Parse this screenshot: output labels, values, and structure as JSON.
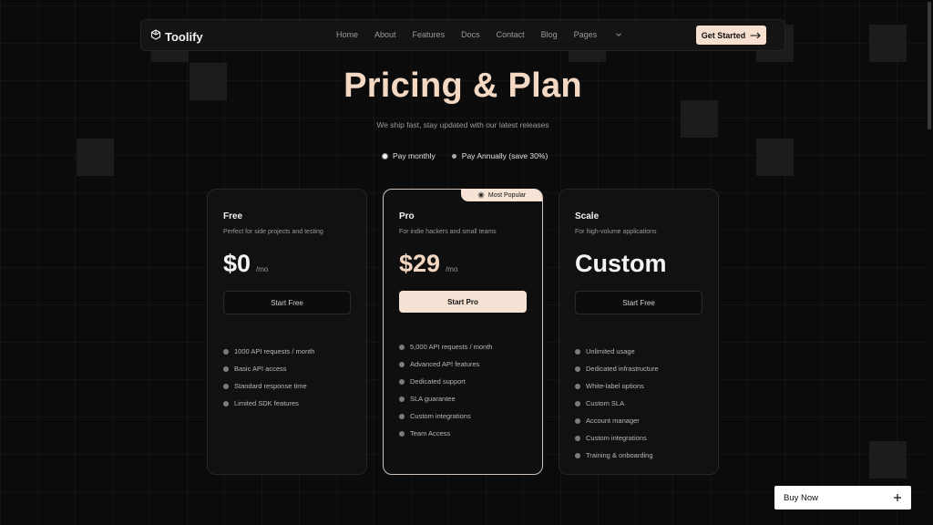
{
  "nav": {
    "brand": "Toolify",
    "links": [
      "Home",
      "About",
      "Features",
      "Docs",
      "Contact",
      "Blog"
    ],
    "pages_label": "Pages",
    "cta_label": "Get Started"
  },
  "hero": {
    "title": "Pricing & Plan",
    "subtitle": "We ship fast, stay updated with our latest releases"
  },
  "billing_toggle": {
    "monthly_label": "Pay monthly",
    "annual_label": "Pay Annually (save 30%)",
    "selected": "monthly"
  },
  "plans": [
    {
      "name": "Free",
      "description": "Perfect for side projects and testing",
      "price": "$0",
      "period": "/mo",
      "button": "Start Free",
      "features": [
        "1000 API requests / month",
        "Basic API access",
        "Standard response time",
        "Limited SDK features"
      ]
    },
    {
      "name": "Pro",
      "badge": "Most Popular",
      "description": "For indie hackers and small teams",
      "price": "$29",
      "period": "/mo",
      "button": "Start Pro",
      "features": [
        "5,000 API requests / month",
        "Advanced API features",
        "Dedicated support",
        "SLA guarantee",
        "Custom integrations",
        "Team Access"
      ]
    },
    {
      "name": "Scale",
      "description": "For high-volume applications",
      "price": "Custom",
      "button": "Start Free",
      "features": [
        "Unlimited usage",
        "Dedicated infrastructure",
        "White-label options",
        "Custom SLA",
        "Account manager",
        "Custom integrations",
        "Training & onboarding"
      ]
    }
  ],
  "floating": {
    "buy_now_label": "Buy Now"
  },
  "colors": {
    "background": "#0b0b0b",
    "accent": "#f7e0cf",
    "title_gradient_start": "#f3d8c4"
  }
}
